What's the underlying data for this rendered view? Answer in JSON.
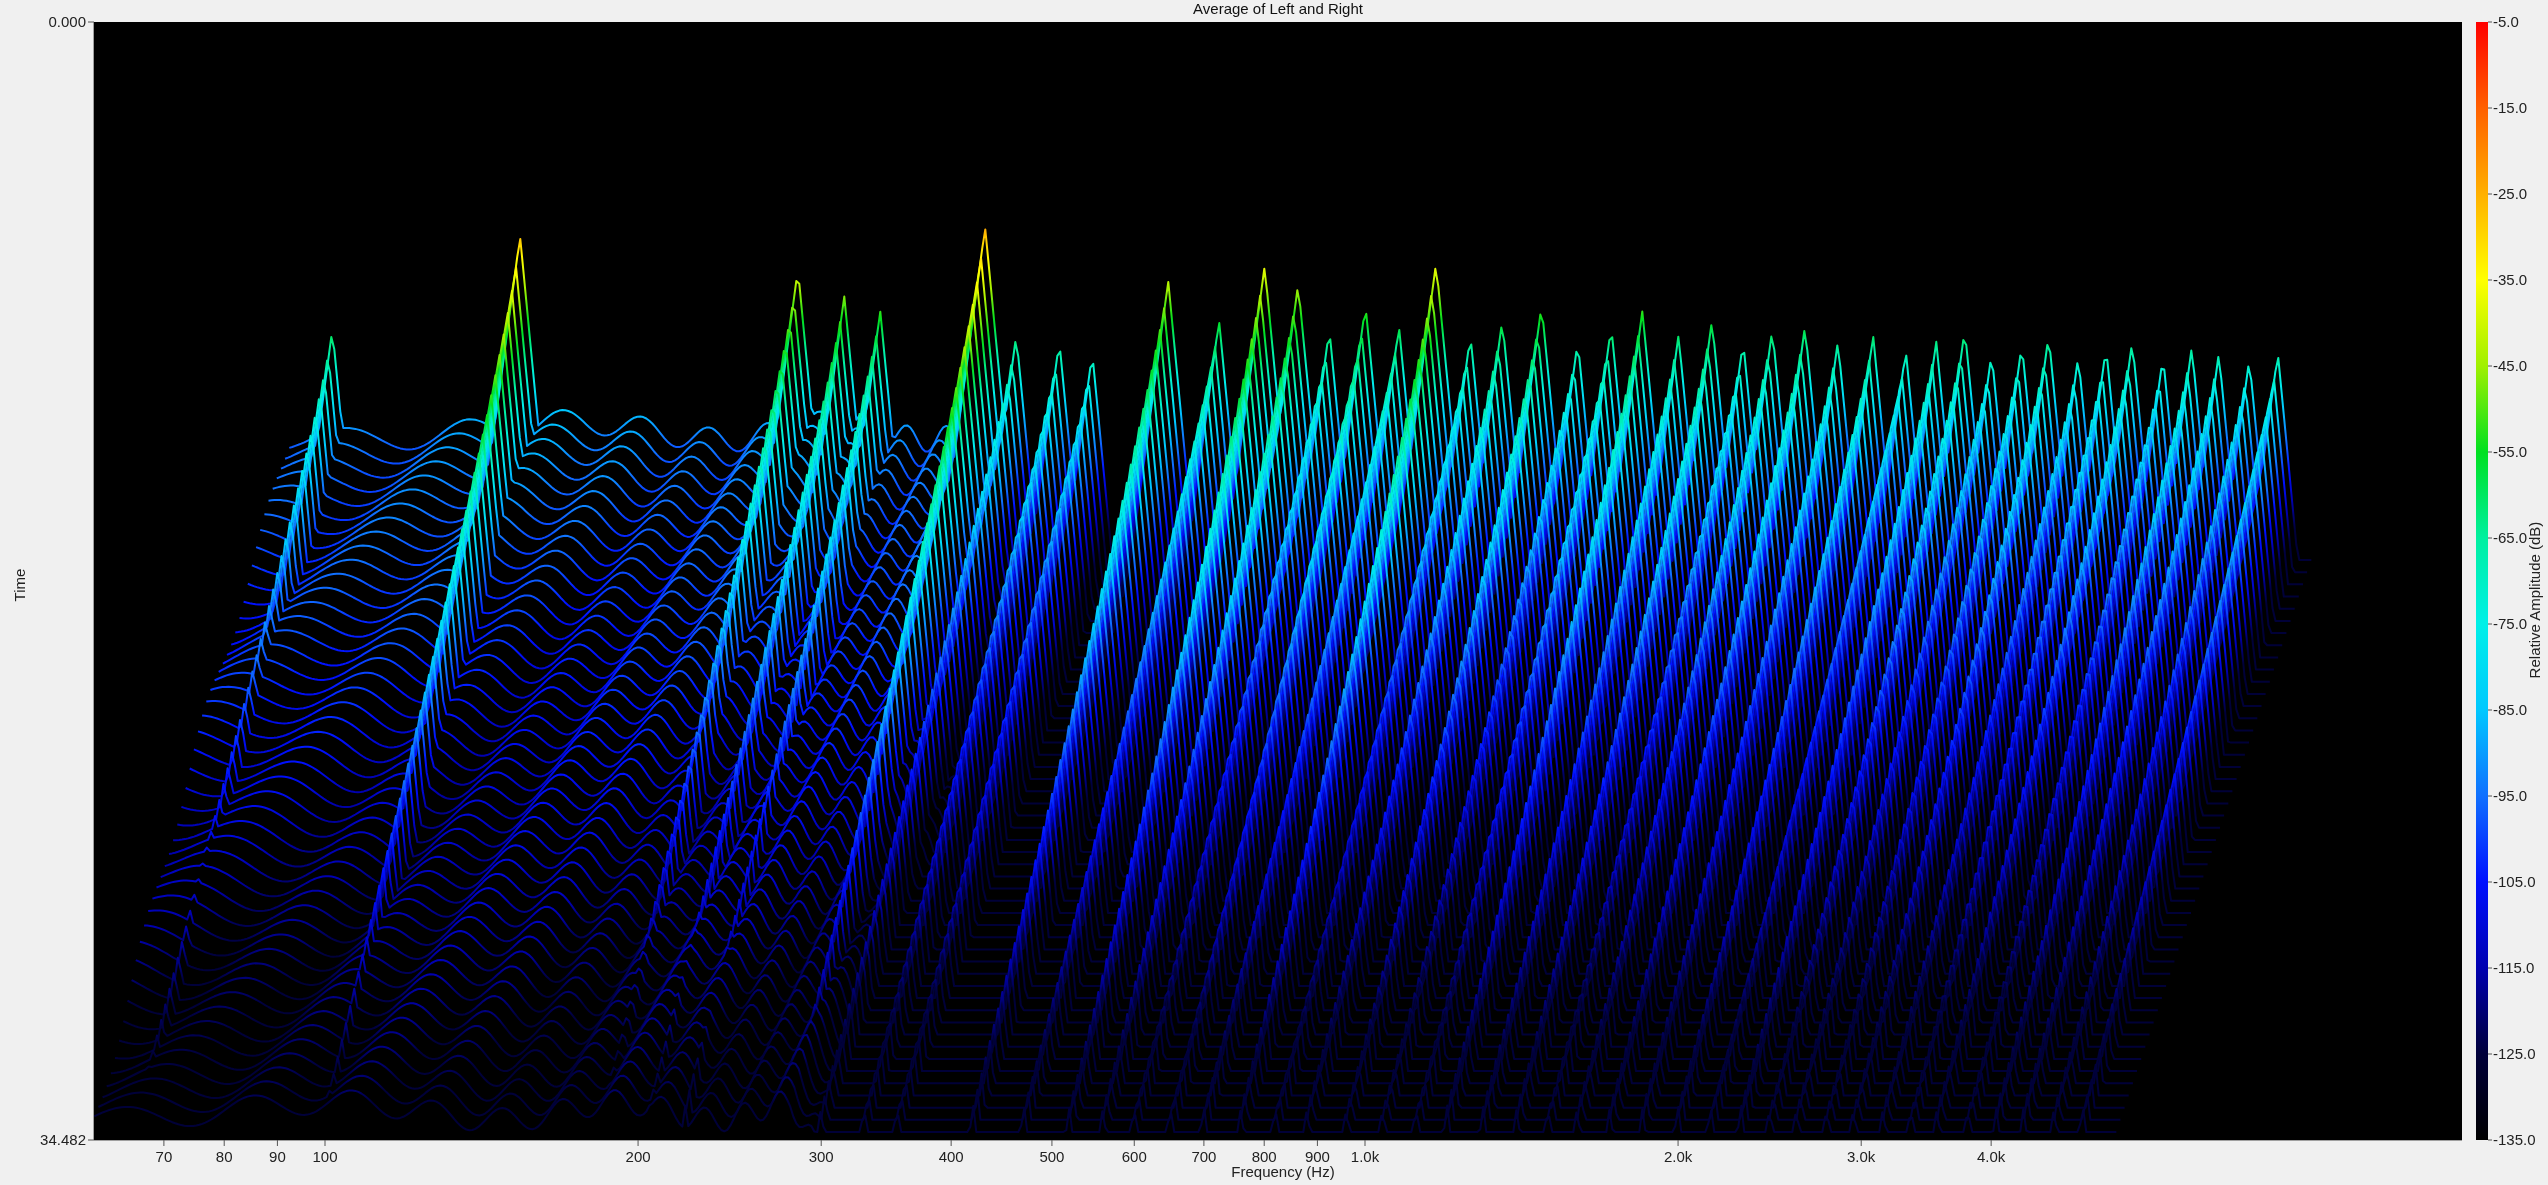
{
  "title": "Average of Left and Right",
  "waterfall": {
    "x_axis": {
      "label": "Frequency (Hz)",
      "ticks": [
        "70",
        "80",
        "90",
        "100",
        "200",
        "300",
        "400",
        "500",
        "600",
        "700",
        "800",
        "900",
        "1.0k",
        "2.0k",
        "3.0k",
        "4.0k"
      ]
    },
    "y_axis": {
      "label": "Time",
      "ticks": [
        "0.000",
        "34.482"
      ]
    },
    "color_scale": {
      "label": "Relative Amplitude (dB)",
      "ticks": [
        "-5.0",
        "-15.0",
        "-25.0",
        "-35.0",
        "-45.0",
        "-55.0",
        "-65.0",
        "-75.0",
        "-85.0",
        "-95.0",
        "-105.0",
        "-115.0",
        "-125.0",
        "-135.0"
      ]
    }
  }
}
